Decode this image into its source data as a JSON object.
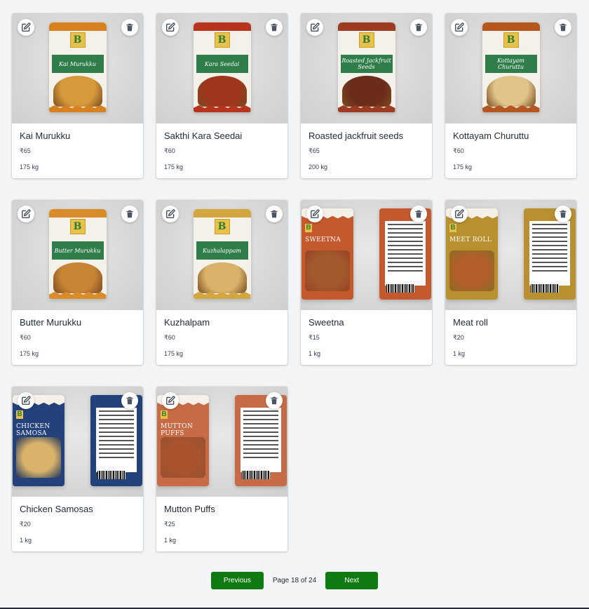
{
  "products": [
    {
      "name": "Kai Murukku",
      "price": "₹65",
      "weight": "175 kg",
      "pack_title": "Kai Murukku",
      "pack_type": "single",
      "colors": {
        "top": "#d8821f",
        "food": "#d79a3b"
      }
    },
    {
      "name": "Sakthi Kara Seedai",
      "price": "₹60",
      "weight": "175 kg",
      "pack_title": "Kara Seedai",
      "pack_type": "single",
      "colors": {
        "top": "#b8341f",
        "food": "#a0351e"
      }
    },
    {
      "name": "Roasted jackfruit seeds",
      "price": "₹65",
      "weight": "200 kg",
      "pack_title": "Roasted Jackfruit Seeds",
      "pack_type": "single",
      "colors": {
        "top": "#9c3a22",
        "food": "#6b2c1a"
      }
    },
    {
      "name": "Kottayam Churuttu",
      "price": "₹60",
      "weight": "175 kg",
      "pack_title": "Kottayam Churuttu",
      "pack_type": "single",
      "colors": {
        "top": "#b5561e",
        "food": "#e0c48a"
      }
    },
    {
      "name": "Butter Murukku",
      "price": "₹60",
      "weight": "175 kg",
      "pack_title": "Butter Murukku",
      "pack_type": "single",
      "colors": {
        "top": "#d98d2a",
        "food": "#c88434"
      }
    },
    {
      "name": "Kuzhalpam",
      "price": "₹60",
      "weight": "175 kg",
      "pack_title": "Kuzhalappam",
      "pack_type": "single",
      "colors": {
        "top": "#d4a640",
        "food": "#d9b36a"
      }
    },
    {
      "name": "Sweetna",
      "price": "₹15",
      "weight": "1 kg",
      "pack_title": "SWEETNA",
      "pack_type": "double",
      "colors": {
        "top": "#c4592e",
        "food": "#a55a2e"
      }
    },
    {
      "name": "Meat roll",
      "price": "₹20",
      "weight": "1 kg",
      "pack_title": "MEET ROLL",
      "pack_type": "double",
      "colors": {
        "top": "#b8902f",
        "food": "#b35f2a"
      }
    },
    {
      "name": "Chicken Samosas",
      "price": "₹20",
      "weight": "1 kg",
      "pack_title": "CHICKEN SAMOSA",
      "pack_type": "double",
      "colors": {
        "top": "#23417a",
        "food": "#d9b36a"
      }
    },
    {
      "name": "Mutton Puffs",
      "price": "₹25",
      "weight": "1 kg",
      "pack_title": "MUTTON PUFFS",
      "pack_type": "double",
      "colors": {
        "top": "#c76b46",
        "food": "#a9542e"
      }
    }
  ],
  "pagination": {
    "previous_label": "Previous",
    "page_info": "Page 18 of 24",
    "next_label": "Next"
  },
  "icons": {
    "edit": "edit-icon",
    "delete": "trash-icon"
  },
  "accent_color": "#0f7a12"
}
